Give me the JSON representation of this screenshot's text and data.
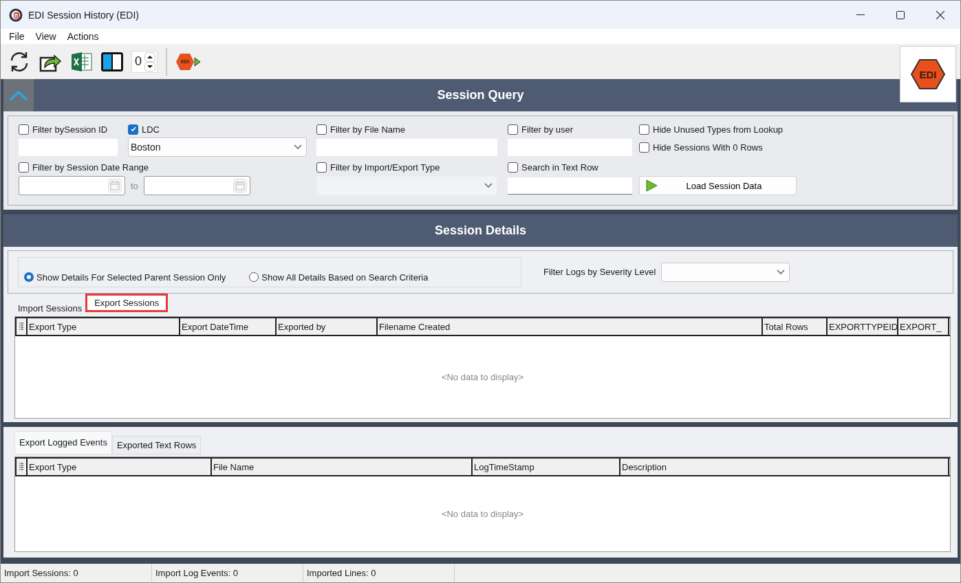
{
  "window": {
    "title": "EDI Session History (EDI)"
  },
  "menu": [
    "File",
    "View",
    "Actions"
  ],
  "toolbar": {
    "spinner_value": "0",
    "edi_button_text": "EDI",
    "logo_text": "EDI"
  },
  "session_query": {
    "title": "Session Query",
    "session_id": {
      "label": "Filter bySession ID",
      "checked": false
    },
    "ldc": {
      "label": "LDC",
      "checked": true,
      "value": "Boston"
    },
    "file_name": {
      "label": "Filter by File Name",
      "checked": false
    },
    "user": {
      "label": "Filter by user",
      "checked": false
    },
    "hide_unused": {
      "label": "Hide Unused Types from Lookup",
      "checked": false
    },
    "hide_zero": {
      "label": "Hide Sessions With 0 Rows",
      "checked": false
    },
    "date_range": {
      "label": "Filter by Session Date Range",
      "checked": false,
      "to_label": "to"
    },
    "type": {
      "label": "Filter by Import/Export Type",
      "checked": false,
      "disabled": true
    },
    "text_row": {
      "label": "Search in Text Row",
      "checked": false
    },
    "load_button": "Load Session Data"
  },
  "session_details": {
    "title": "Session Details",
    "scope_options": [
      {
        "label": "Show Details For Selected Parent Session Only",
        "selected": true
      },
      {
        "label": "Show All Details Based on Search Criteria",
        "selected": false
      }
    ],
    "severity_label": "Filter Logs by Severity Level",
    "tabs": [
      {
        "label": "Import Sessions",
        "selected": false
      },
      {
        "label": "Export Sessions",
        "selected": true
      }
    ],
    "table": {
      "columns": [
        "Export Type",
        "Export DateTime",
        "Exported by",
        "Filename Created",
        "Total Rows",
        "EXPORTTYPEID",
        "EXPORT_"
      ],
      "empty_text": "<No data to display>"
    },
    "log_tabs": [
      {
        "label": "Export Logged Events",
        "selected": true
      },
      {
        "label": "Exported Text Rows",
        "selected": false
      }
    ],
    "log_table": {
      "columns": [
        "Export Type",
        "File Name",
        "LogTimeStamp",
        "Description"
      ],
      "empty_text": "<No data to display>"
    }
  },
  "status_bar": [
    "Import Sessions: 0",
    "Import Log Events: 0",
    "Imported Lines: 0"
  ]
}
